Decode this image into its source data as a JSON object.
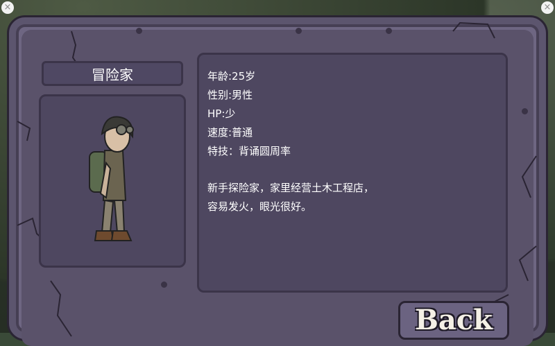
{
  "character": {
    "name": "冒险家",
    "stats": [
      "年龄:25岁",
      "性别:男性",
      "HP:少",
      "速度:普通",
      "特技：背诵圆周率"
    ],
    "description": [
      "新手探险家，家里经营土木工程店，",
      "容易发火，眼光很好。"
    ]
  },
  "buttons": {
    "back_label": "Back"
  },
  "colors": {
    "panel": "#6e6682",
    "inner_box": "#4e4760",
    "outline": "#2a2433",
    "text": "#ffffff"
  },
  "icons": {
    "portrait": "explorer-character-icon"
  }
}
